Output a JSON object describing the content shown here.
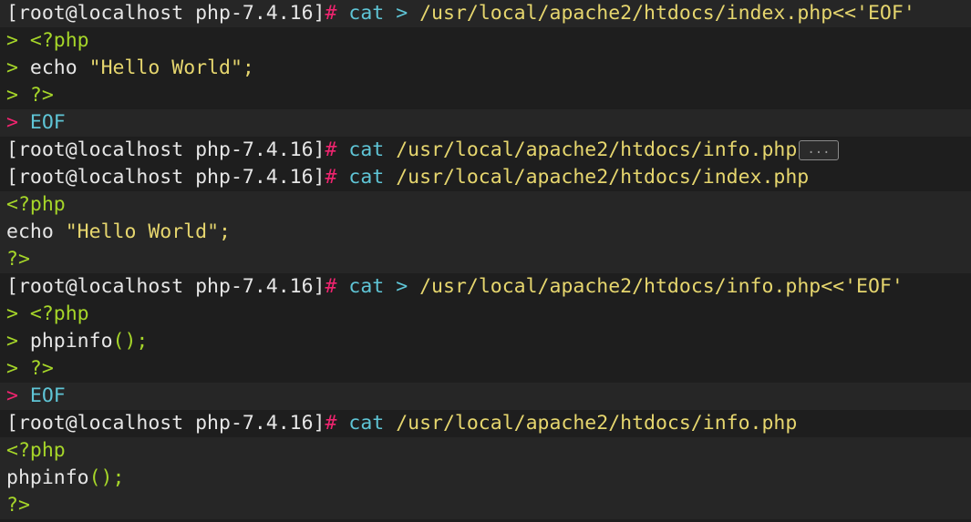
{
  "terminal": {
    "lines": [
      {
        "prompt": "[root@localhost php-7.4.16]",
        "hash": "#",
        "cmd": "cat",
        "op": ">",
        "path": "/usr/local/apache2/htdocs/index.php<<'EOF'"
      },
      {
        "cont": ">",
        "text": "<?php"
      },
      {
        "cont": ">",
        "kw": "echo",
        "str": "\"Hello World\";"
      },
      {
        "cont": ">",
        "text": "?>"
      },
      {
        "cont": ">",
        "eof": "EOF"
      },
      {
        "prompt": "[root@localhost php-7.4.16]",
        "hash": "#",
        "cmd": "cat",
        "path": "/usr/local/apache2/htdocs/info.php",
        "ellipsis": "..."
      },
      {
        "prompt": "[root@localhost php-7.4.16]",
        "hash": "#",
        "cmd": "cat",
        "path": "/usr/local/apache2/htdocs/index.php"
      },
      {
        "text": "<?php"
      },
      {
        "kw": "echo",
        "str": "\"Hello World\";"
      },
      {
        "text": "?>"
      },
      {
        "prompt": "[root@localhost php-7.4.16]",
        "hash": "#",
        "cmd": "cat",
        "op": ">",
        "path": "/usr/local/apache2/htdocs/info.php<<'EOF'"
      },
      {
        "cont": ">",
        "text": "<?php"
      },
      {
        "cont": ">",
        "fn": "phpinfo",
        "parens": "();"
      },
      {
        "cont": ">",
        "text": "?>"
      },
      {
        "cont": ">",
        "eof": "EOF"
      },
      {
        "prompt": "[root@localhost php-7.4.16]",
        "hash": "#",
        "cmd": "cat",
        "path": "/usr/local/apache2/htdocs/info.php"
      },
      {
        "text": "<?php"
      },
      {
        "fn": "phpinfo",
        "parens": "();"
      },
      {
        "text": "?>"
      }
    ]
  },
  "colors": {
    "background": "#1e1e1e",
    "alt_row": "#262626",
    "text": "#e6e6e6",
    "hash": "#f0246f",
    "command": "#5fc5d6",
    "path": "#e6d66e",
    "php": "#a6d629"
  }
}
